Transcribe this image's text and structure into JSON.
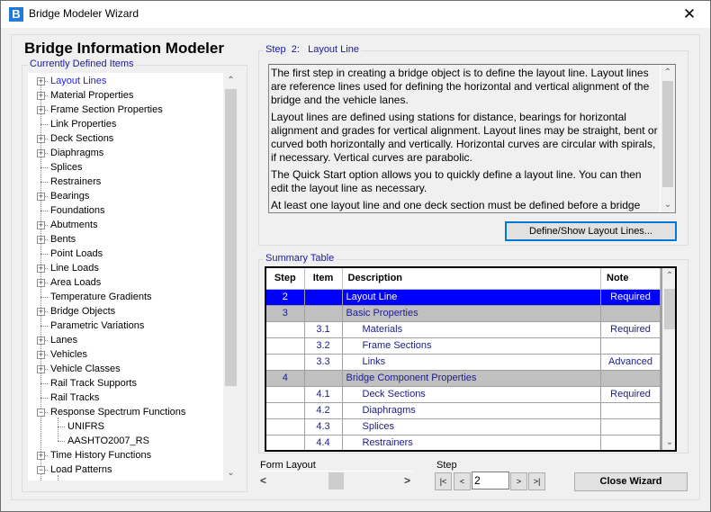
{
  "window": {
    "title": "Bridge Modeler Wizard",
    "app_icon_letter": "B",
    "close_glyph": "✕"
  },
  "main_title": "Bridge Information Modeler",
  "tree": {
    "legend": "Currently Defined Items",
    "items": [
      {
        "label": "Layout Lines",
        "expander": "+",
        "level": 0,
        "selected": true
      },
      {
        "label": "Material Properties",
        "expander": "+",
        "level": 0
      },
      {
        "label": "Frame Section Properties",
        "expander": "+",
        "level": 0
      },
      {
        "label": "Link Properties",
        "expander": "",
        "level": 0
      },
      {
        "label": "Deck Sections",
        "expander": "+",
        "level": 0
      },
      {
        "label": "Diaphragms",
        "expander": "+",
        "level": 0
      },
      {
        "label": "Splices",
        "expander": "",
        "level": 0
      },
      {
        "label": "Restrainers",
        "expander": "",
        "level": 0
      },
      {
        "label": "Bearings",
        "expander": "+",
        "level": 0
      },
      {
        "label": "Foundations",
        "expander": "",
        "level": 0
      },
      {
        "label": "Abutments",
        "expander": "+",
        "level": 0
      },
      {
        "label": "Bents",
        "expander": "+",
        "level": 0
      },
      {
        "label": "Point Loads",
        "expander": "",
        "level": 0
      },
      {
        "label": "Line Loads",
        "expander": "+",
        "level": 0
      },
      {
        "label": "Area Loads",
        "expander": "+",
        "level": 0
      },
      {
        "label": "Temperature Gradients",
        "expander": "",
        "level": 0
      },
      {
        "label": "Bridge Objects",
        "expander": "+",
        "level": 0
      },
      {
        "label": "Parametric Variations",
        "expander": "",
        "level": 0
      },
      {
        "label": "Lanes",
        "expander": "+",
        "level": 0
      },
      {
        "label": "Vehicles",
        "expander": "+",
        "level": 0
      },
      {
        "label": "Vehicle Classes",
        "expander": "+",
        "level": 0
      },
      {
        "label": "Rail Track Supports",
        "expander": "",
        "level": 0
      },
      {
        "label": "Rail Tracks",
        "expander": "",
        "level": 0
      },
      {
        "label": "Response Spectrum Functions",
        "expander": "−",
        "level": 0
      },
      {
        "label": "UNIFRS",
        "expander": "",
        "level": 1
      },
      {
        "label": "AASHTO2007_RS",
        "expander": "",
        "level": 1
      },
      {
        "label": "Time History Functions",
        "expander": "+",
        "level": 0
      },
      {
        "label": "Load Patterns",
        "expander": "−",
        "level": 0
      }
    ]
  },
  "step_panel": {
    "legend": "Step  2:   Layout Line",
    "paragraphs": [
      "The first step in creating a bridge object is to define the layout line. Layout lines are reference lines used for defining the horizontal and vertical alignment of the bridge and the vehicle lanes.",
      "Layout lines are defined using stations for distance, bearings for horizontal alignment and grades for vertical alignment. Layout lines may be straight, bent or curved both horizontally and vertically. Horizontal curves are circular with spirals, if necessary. Vertical curves are parabolic.",
      "The Quick Start option allows you to quickly define a layout line. You can then edit the layout line as necessary.",
      "At least one layout line and one deck section must be defined before a bridge"
    ],
    "define_button": "Define/Show Layout Lines..."
  },
  "summary": {
    "legend": "Summary Table",
    "columns": [
      "Step",
      "Item",
      "Description",
      "Note"
    ],
    "rows": [
      {
        "step": "2",
        "item": "",
        "description": "Layout Line",
        "note": "Required",
        "type": "sel"
      },
      {
        "step": "3",
        "item": "",
        "description": "Basic Properties",
        "note": "",
        "type": "group"
      },
      {
        "step": "",
        "item": "3.1",
        "description": "Materials",
        "note": "Required",
        "type": "sub"
      },
      {
        "step": "",
        "item": "3.2",
        "description": "Frame Sections",
        "note": "",
        "type": "sub"
      },
      {
        "step": "",
        "item": "3.3",
        "description": "Links",
        "note": "Advanced",
        "type": "sub"
      },
      {
        "step": "4",
        "item": "",
        "description": "Bridge Component Properties",
        "note": "",
        "type": "group"
      },
      {
        "step": "",
        "item": "4.1",
        "description": "Deck Sections",
        "note": "Required",
        "type": "sub"
      },
      {
        "step": "",
        "item": "4.2",
        "description": "Diaphragms",
        "note": "",
        "type": "sub"
      },
      {
        "step": "",
        "item": "4.3",
        "description": "Splices",
        "note": "",
        "type": "sub"
      },
      {
        "step": "",
        "item": "4.4",
        "description": "Restrainers",
        "note": "",
        "type": "sub"
      }
    ]
  },
  "form_layout": {
    "label": "Form Layout",
    "left_arrow": "<",
    "right_arrow": ">"
  },
  "step_nav": {
    "label": "Step",
    "first": "|<",
    "prev": "<",
    "value": "2",
    "next": ">",
    "last": ">|"
  },
  "close_wizard_button": "Close Wizard",
  "scroll_glyphs": {
    "up": "⌃",
    "down": "⌄"
  }
}
